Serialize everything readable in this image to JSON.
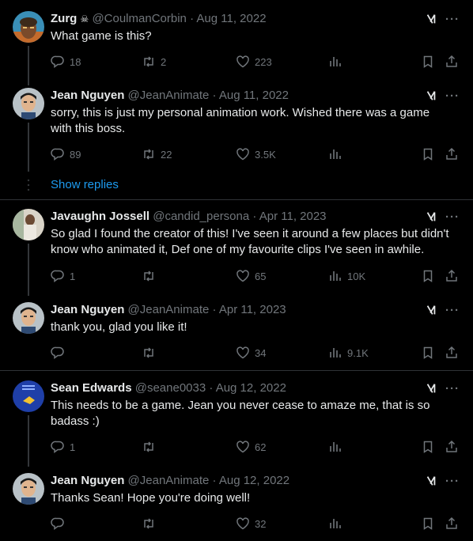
{
  "colors": {
    "background": "#000000",
    "text": "#e7e9ea",
    "muted": "#71767b",
    "link": "#1d9bf0",
    "divider": "#2f3336"
  },
  "tweets": [
    {
      "name": "Zurg",
      "name_emoji": "☠",
      "handle": "@CoulmanCorbin",
      "date": "Aug 11, 2022",
      "text": "What game is this?",
      "replies": "18",
      "retweets": "2",
      "likes": "223",
      "views": ""
    },
    {
      "name": "Jean Nguyen",
      "handle": "@JeanAnimate",
      "date": "Aug 11, 2022",
      "text": "sorry, this is just my personal animation work. Wished there was a game with this boss.",
      "replies": "89",
      "retweets": "22",
      "likes": "3.5K",
      "views": ""
    },
    {
      "name": "Javaughn Jossell",
      "handle": "@candid_persona",
      "date": "Apr 11, 2023",
      "text": "So glad I found the creator of this! I've seen it around a few places but didn't know who animated it, Def one of my favourite clips I've seen in awhile.",
      "replies": "1",
      "retweets": "",
      "likes": "65",
      "views": "10K"
    },
    {
      "name": "Jean Nguyen",
      "handle": "@JeanAnimate",
      "date": "Apr 11, 2023",
      "text": "thank you, glad you like it!",
      "replies": "",
      "retweets": "",
      "likes": "34",
      "views": "9.1K"
    },
    {
      "name": "Sean Edwards",
      "handle": "@seane0033",
      "date": "Aug 12, 2022",
      "text": "This needs to be a game. Jean you never cease to amaze me, that is so badass :)",
      "replies": "1",
      "retweets": "",
      "likes": "62",
      "views": ""
    },
    {
      "name": "Jean Nguyen",
      "handle": "@JeanAnimate",
      "date": "Aug 12, 2022",
      "text": "Thanks Sean! Hope you're doing well!",
      "replies": "",
      "retweets": "",
      "likes": "32",
      "views": ""
    }
  ],
  "show_replies_label": "Show replies",
  "separator": "·",
  "more_label": "···",
  "icons": {
    "reply": "speech-bubble",
    "retweet": "retweet-arrows",
    "like": "heart",
    "views": "bar-chart",
    "bookmark": "bookmark",
    "share": "upload-arrow",
    "grok": "grok-slash",
    "more": "ellipsis"
  }
}
